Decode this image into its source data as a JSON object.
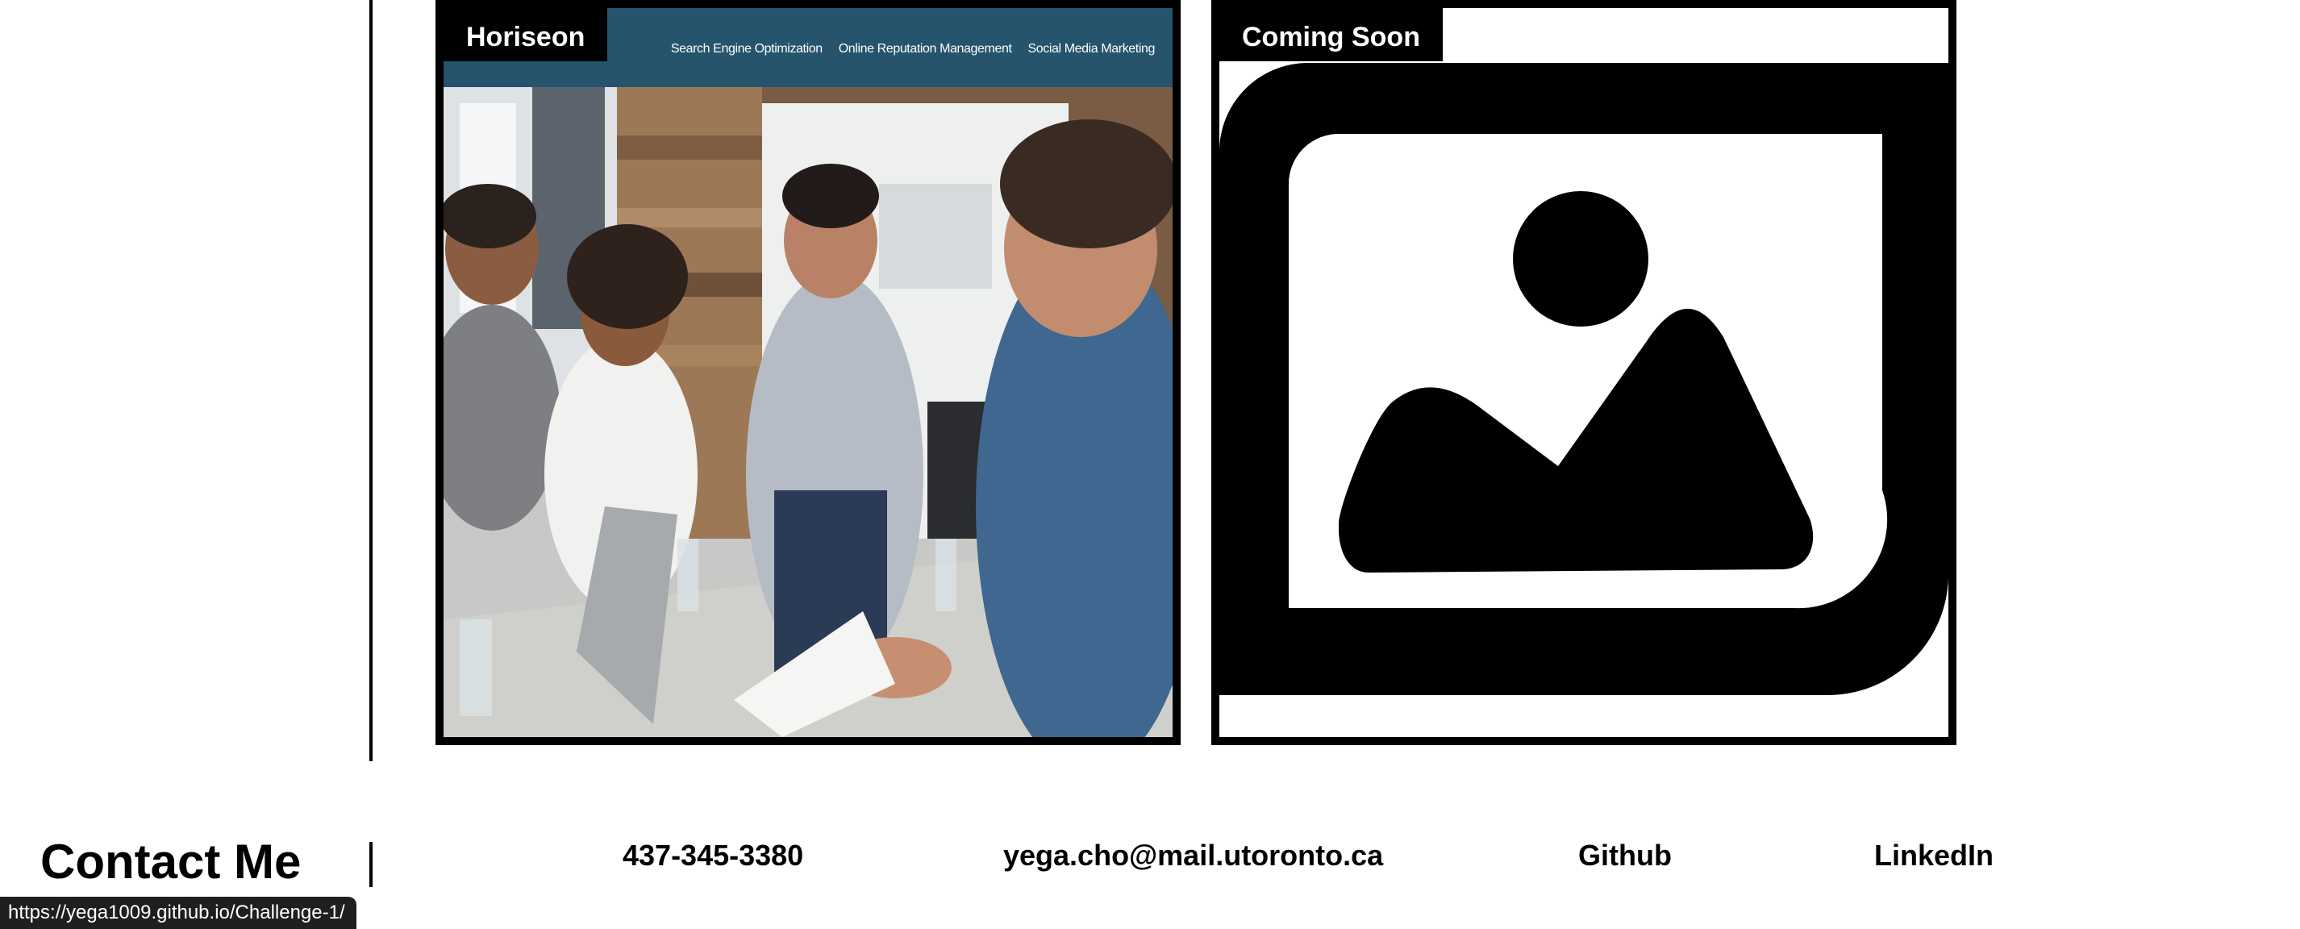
{
  "portfolio": {
    "projects": [
      {
        "label": "Horiseon",
        "nav": [
          "Search Engine Optimization",
          "Online Reputation Management",
          "Social Media Marketing"
        ]
      },
      {
        "label": "Coming Soon"
      }
    ]
  },
  "contact": {
    "title": "Contact Me",
    "phone": "437-345-3380",
    "email": "yega.cho@mail.utoronto.ca",
    "github": "Github",
    "linkedin": "LinkedIn"
  },
  "status_bar": {
    "url": "https://yega1009.github.io/Challenge-1/"
  },
  "colors": {
    "horiseon_header": "#25546c",
    "card_border": "#000000",
    "status_bar_bg": "#1f1f1f"
  },
  "icons": [
    "image-placeholder-icon"
  ]
}
